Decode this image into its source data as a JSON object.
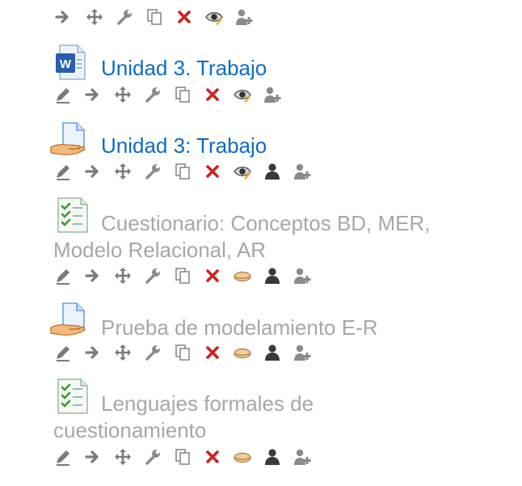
{
  "colors": {
    "link": "#0f6cbf",
    "dimmed": "#a7a7a7",
    "icon_gray": "#7a7a7a",
    "delete_red": "#cc2222"
  },
  "activities": [
    {
      "name": "",
      "type_icon": "none",
      "visible": true,
      "actions": [
        "move-right-icon",
        "move-icon",
        "settings-wrench-icon",
        "duplicate-icon",
        "delete-icon",
        "show-hide-eye-icon",
        "assign-roles-icon"
      ]
    },
    {
      "name": "Unidad 3. Trabajo",
      "type_icon": "word-document-icon",
      "visible": true,
      "actions": [
        "edit-title-pencil-icon",
        "move-right-icon",
        "move-icon",
        "settings-wrench-icon",
        "duplicate-icon",
        "delete-icon",
        "show-hide-eye-icon",
        "assign-roles-icon"
      ]
    },
    {
      "name": "Unidad 3: Trabajo",
      "type_icon": "assignment-icon",
      "visible": true,
      "actions": [
        "edit-title-pencil-icon",
        "move-right-icon",
        "move-icon",
        "settings-wrench-icon",
        "duplicate-icon",
        "delete-icon",
        "show-hide-eye-icon",
        "group-mode-person-icon",
        "assign-roles-icon"
      ]
    },
    {
      "name": "Cuestionario: Conceptos BD, MER, Modelo Relacional, AR",
      "name_line1": "Cuestionario: Conceptos BD, MER,",
      "name_line2": "Modelo Relacional, AR",
      "type_icon": "quiz-icon",
      "visible": false,
      "actions": [
        "edit-title-pencil-icon",
        "move-right-icon",
        "move-icon",
        "settings-wrench-icon",
        "duplicate-icon",
        "delete-icon",
        "hidden-eye-closed-icon",
        "group-mode-person-icon",
        "assign-roles-icon"
      ]
    },
    {
      "name": "Prueba de modelamiento E-R",
      "type_icon": "assignment-icon",
      "visible": false,
      "actions": [
        "edit-title-pencil-icon",
        "move-right-icon",
        "move-icon",
        "settings-wrench-icon",
        "duplicate-icon",
        "delete-icon",
        "hidden-eye-closed-icon",
        "group-mode-person-icon",
        "assign-roles-icon"
      ]
    },
    {
      "name": "Lenguajes formales de cuestionamiento",
      "name_line1": "Lenguajes formales de",
      "name_line2": "cuestionamiento",
      "type_icon": "quiz-icon",
      "visible": false,
      "actions": [
        "edit-title-pencil-icon",
        "move-right-icon",
        "move-icon",
        "settings-wrench-icon",
        "duplicate-icon",
        "delete-icon",
        "hidden-eye-closed-icon",
        "group-mode-person-icon",
        "assign-roles-icon"
      ]
    }
  ]
}
